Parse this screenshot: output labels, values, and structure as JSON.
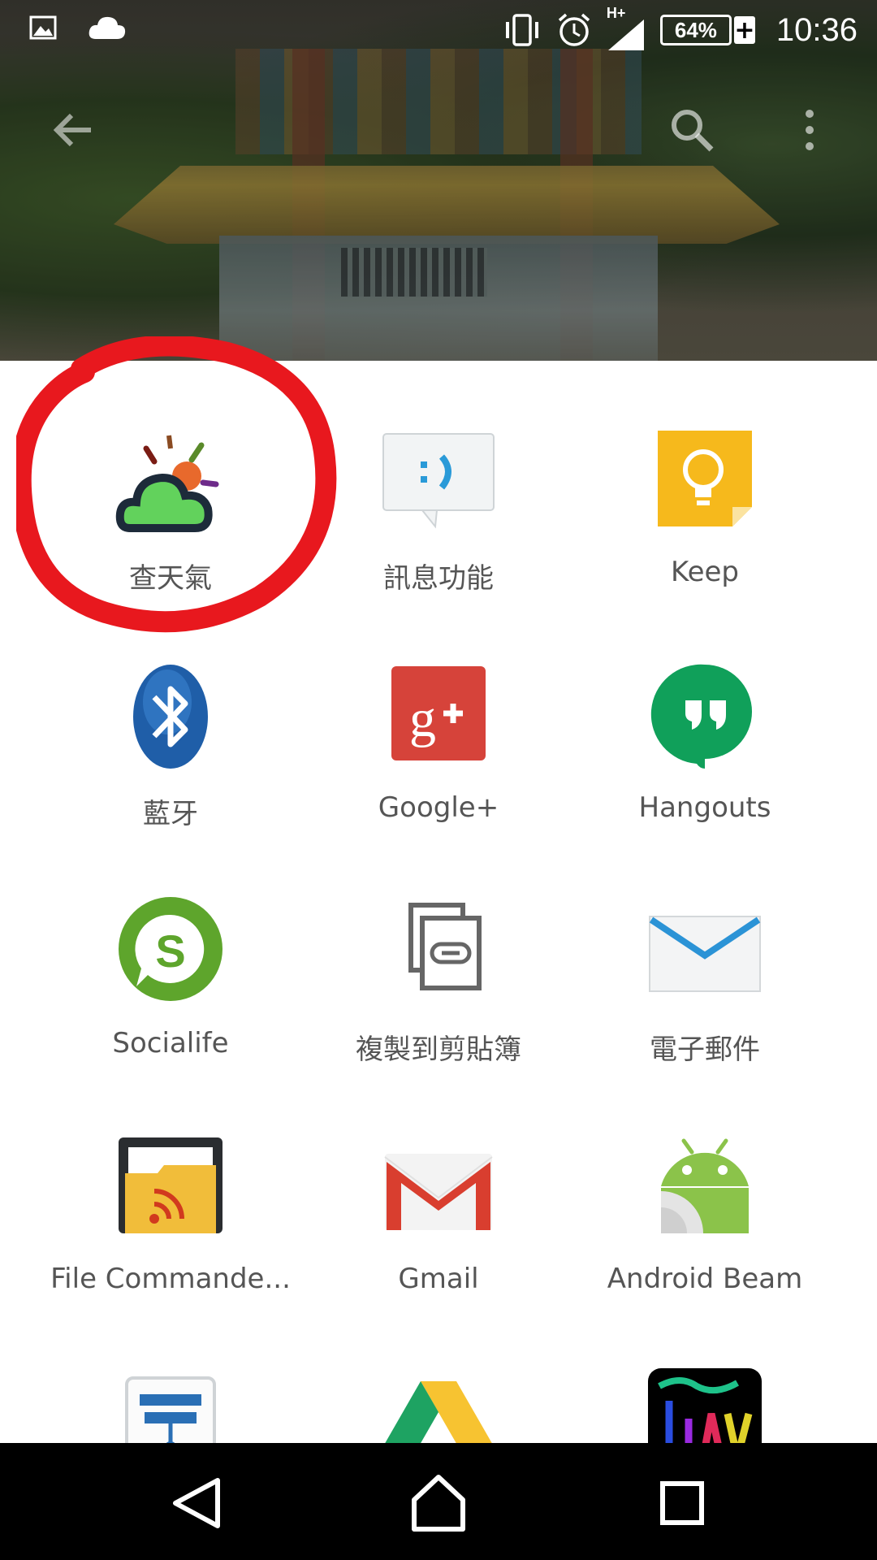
{
  "status_bar": {
    "time": "10:36",
    "battery_percent": "64%",
    "battery_charging_symbol": "+",
    "network_type": "H+",
    "icons": [
      "image-icon",
      "cloud-icon",
      "vibrate-icon",
      "alarm-icon",
      "signal-icon",
      "battery-icon"
    ]
  },
  "toolbar": {
    "icons": [
      "back-arrow-icon",
      "search-icon",
      "more-vert-icon"
    ]
  },
  "share_targets": [
    {
      "label": "查天氣",
      "icon": "weather-cloud-icon"
    },
    {
      "label": "訊息功能",
      "icon": "messaging-icon"
    },
    {
      "label": "Keep",
      "icon": "keep-bulb-icon"
    },
    {
      "label": "藍牙",
      "icon": "bluetooth-icon"
    },
    {
      "label": "Google+",
      "icon": "google-plus-icon"
    },
    {
      "label": "Hangouts",
      "icon": "hangouts-icon"
    },
    {
      "label": "Socialife",
      "icon": "socialife-icon"
    },
    {
      "label": "複製到剪貼簿",
      "icon": "copy-link-icon"
    },
    {
      "label": "電子郵件",
      "icon": "email-envelope-icon"
    },
    {
      "label": "File Commande...",
      "icon": "file-commander-icon"
    },
    {
      "label": "Gmail",
      "icon": "gmail-icon"
    },
    {
      "label": "Android Beam",
      "icon": "android-beam-icon"
    },
    {
      "label": "",
      "icon": "network-diagram-icon"
    },
    {
      "label": "",
      "icon": "google-drive-icon"
    },
    {
      "label": "",
      "icon": "tiny-app-icon"
    }
  ],
  "annotation": {
    "highlight": "red circle around 查天氣"
  },
  "nav_bar": {
    "icons": [
      "nav-back-icon",
      "nav-home-icon",
      "nav-recents-icon"
    ]
  },
  "colors": {
    "highlight_red": "#e8181e",
    "label_gray": "#555555",
    "nav_bg": "#000000"
  }
}
